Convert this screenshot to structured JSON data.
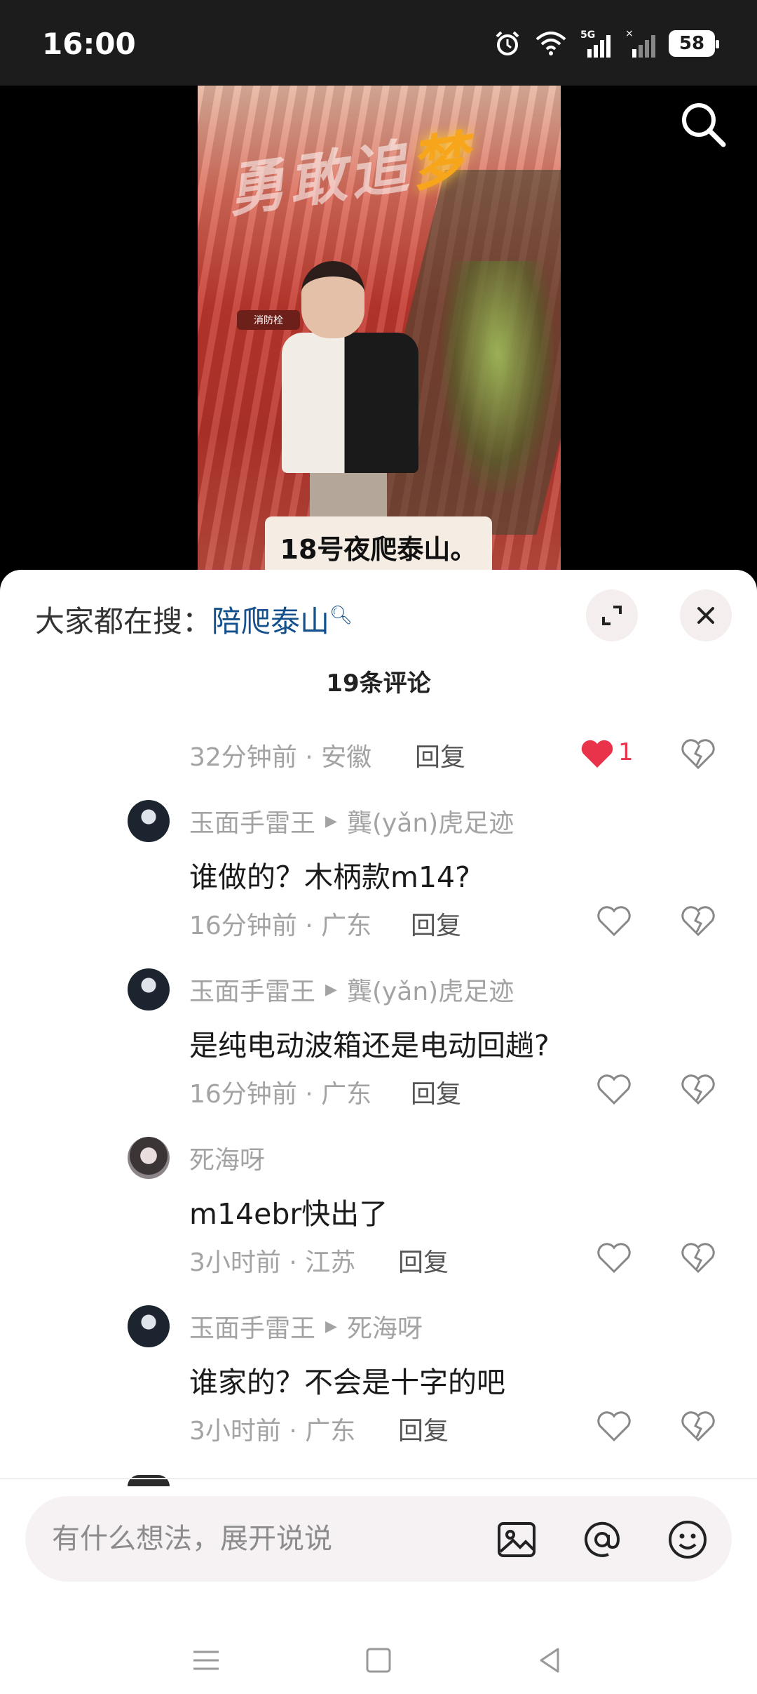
{
  "status_bar": {
    "time": "16:00",
    "battery": "58",
    "network": "5G"
  },
  "video": {
    "title_main": "勇敢追",
    "title_glow": "梦",
    "sign_text": "消防栓",
    "caption": "18号夜爬泰山。"
  },
  "sheet": {
    "trending_label": "大家都在搜：",
    "trending_keyword": "陪爬泰山",
    "comment_count": "19条评论"
  },
  "comments": [
    {
      "meta": "32分钟前 · 安徽",
      "reply": "回复",
      "likes": "1",
      "liked": true
    },
    {
      "author": "玉面手雷王",
      "reply_to": "龔(yǎn)虎足迹",
      "text": "谁做的？木柄款m14?",
      "meta": "16分钟前 · 广东",
      "reply": "回复"
    },
    {
      "author": "玉面手雷王",
      "reply_to": "龔(yǎn)虎足迹",
      "text": "是纯电动波箱还是电动回趟?",
      "meta": "16分钟前 · 广东",
      "reply": "回复"
    },
    {
      "author": "死海呀",
      "text": "m14ebr快出了",
      "meta": "3小时前 · 江苏",
      "reply": "回复"
    },
    {
      "author": "玉面手雷王",
      "reply_to": "死海呀",
      "text": "谁家的？不会是十字的吧",
      "meta": "3小时前 · 广东",
      "reply": "回复"
    }
  ],
  "composer": {
    "placeholder": "有什么想法，展开说说"
  },
  "colors": {
    "accent_blue": "#14508c",
    "like_red": "#e8334a"
  }
}
